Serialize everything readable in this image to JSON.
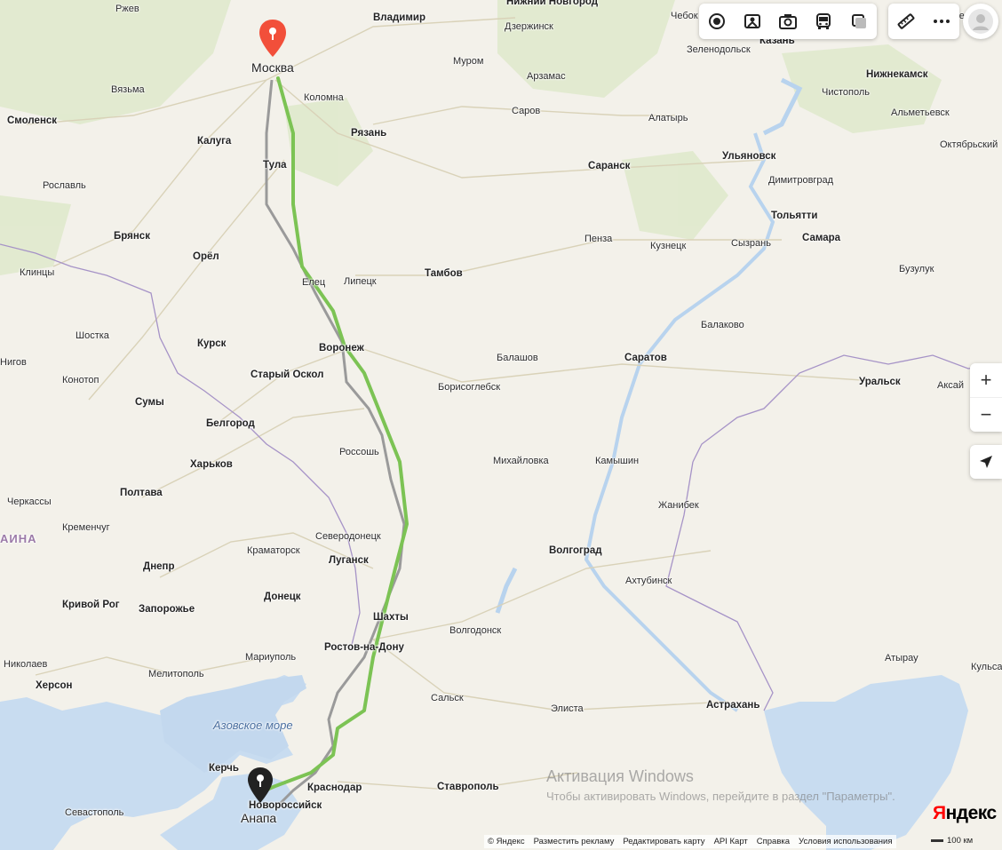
{
  "map_provider": "Яндекс",
  "route": {
    "start_label": "Москва",
    "end_label": "Анапа",
    "route_color": "#7cc354",
    "alt_route_color": "#9a9a9a"
  },
  "sea_label": "Азовское море",
  "country_label": "АИНА",
  "cities": [
    "Ржев",
    "Нижний Новгород",
    "Владимир",
    "Дзержинск",
    "Чебок",
    "Казань",
    "Набережные Челны",
    "Нижнекамск",
    "Москва",
    "Муром",
    "Арзамас",
    "Зеленодольск",
    "Вязьма",
    "Коломна",
    "Смоленск",
    "Рязань",
    "Калуга",
    "Саров",
    "Алатырь",
    "Чистополь",
    "Альметьевск",
    "Тула",
    "Саранск",
    "Ульяновск",
    "Октябрьский",
    "Рославль",
    "Димитровград",
    "Брянск",
    "Пенза",
    "Тольятти",
    "Самара",
    "Кузнецк",
    "Сызрань",
    "Орёл",
    "Клинцы",
    "Липецк",
    "Тамбов",
    "Бузулук",
    "Елец",
    "Балаково",
    "Шостка",
    "Курск",
    "Воронеж",
    "Балашов",
    "Саратов",
    "Уральск",
    "Аксай",
    "Конотоп",
    "Старый Оскол",
    "Борисоглебск",
    "Сумы",
    "Белгород",
    "Россошь",
    "Михайловка",
    "Камышин",
    "Харьков",
    "Жанибек",
    "Полтава",
    "Черкассы",
    "Кременчуг",
    "Северодонецк",
    "Краматорск",
    "Луганск",
    "Волгоград",
    "Днепр",
    "Донецк",
    "Ахтубинск",
    "Кривой Рог",
    "Запорожье",
    "Шахты",
    "Волгодонск",
    "Ростов-на-Дону",
    "Николаев",
    "Мариуполь",
    "Мелитополь",
    "Атырау",
    "Кульса",
    "Херсон",
    "Сальск",
    "Элиста",
    "Астрахань",
    "Керчь",
    "Краснодар",
    "Ставрополь",
    "Севастополь",
    "Новороссийск",
    "Анапа",
    "Нигов"
  ],
  "toolbar": {
    "icons": [
      "layers-icon",
      "panorama-icon",
      "camera-icon",
      "transport-icon",
      "traffic-icon"
    ],
    "extra": [
      "ruler-icon",
      "more-icon"
    ]
  },
  "zoom": {
    "in": "+",
    "out": "−"
  },
  "watermark": {
    "line1": "Активация Windows",
    "line2": "Чтобы активировать Windows, перейдите в раздел \"Параметры\"."
  },
  "footer": {
    "copyright": "© Яндекс",
    "links": [
      "Разместить рекламу",
      "Редактировать карту",
      "API Карт",
      "Справка",
      "Условия использования"
    ]
  },
  "scale": "100 км",
  "logo": {
    "first": "Я",
    "rest": "ндекс"
  }
}
